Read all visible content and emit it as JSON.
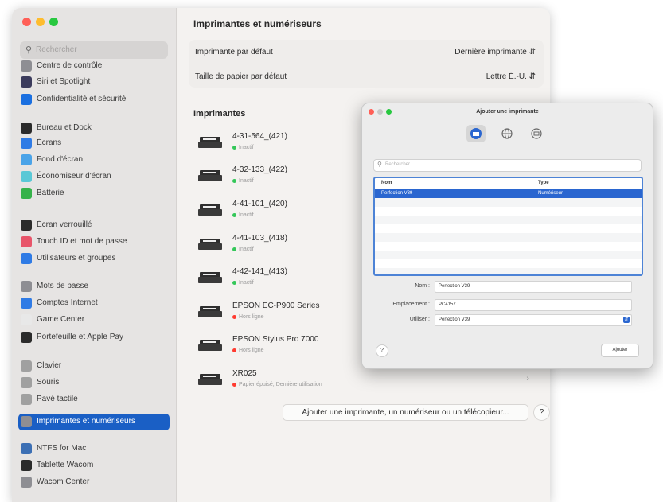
{
  "sidebar": {
    "search_placeholder": "Rechercher",
    "items": [
      {
        "label": "Centre de contrôle",
        "icon": "control-center-icon",
        "color": "#8e8e93"
      },
      {
        "label": "Siri et Spotlight",
        "icon": "siri-icon",
        "color": "#3b3b5c"
      },
      {
        "label": "Confidentialité et sécurité",
        "icon": "privacy-hand-icon",
        "color": "#1a6fe0"
      },
      {
        "label": "Bureau et Dock",
        "icon": "dock-icon",
        "color": "#2b2b2b"
      },
      {
        "label": "Écrans",
        "icon": "display-icon",
        "color": "#2f7be5"
      },
      {
        "label": "Fond d'écran",
        "icon": "wallpaper-icon",
        "color": "#4aa3e8"
      },
      {
        "label": "Économiseur d'écran",
        "icon": "screensaver-icon",
        "color": "#5ac8d6"
      },
      {
        "label": "Batterie",
        "icon": "battery-icon",
        "color": "#36b24a"
      },
      {
        "label": "Écran verrouillé",
        "icon": "lock-screen-icon",
        "color": "#2b2b2b"
      },
      {
        "label": "Touch ID et mot de passe",
        "icon": "fingerprint-icon",
        "color": "#e8556a"
      },
      {
        "label": "Utilisateurs et groupes",
        "icon": "users-icon",
        "color": "#2f7be5"
      },
      {
        "label": "Mots de passe",
        "icon": "key-icon",
        "color": "#8e8e93"
      },
      {
        "label": "Comptes Internet",
        "icon": "at-icon",
        "color": "#2f7be5"
      },
      {
        "label": "Game Center",
        "icon": "game-center-icon",
        "color": "#e8e8e8"
      },
      {
        "label": "Portefeuille et Apple Pay",
        "icon": "wallet-icon",
        "color": "#2b2b2b"
      },
      {
        "label": "Clavier",
        "icon": "keyboard-icon",
        "color": "#a0a0a0"
      },
      {
        "label": "Souris",
        "icon": "mouse-icon",
        "color": "#a0a0a0"
      },
      {
        "label": "Pavé tactile",
        "icon": "trackpad-icon",
        "color": "#a0a0a0"
      },
      {
        "label": "Imprimantes et numériseurs",
        "icon": "printer-icon",
        "color": "#8e8e93",
        "selected": true
      },
      {
        "label": "NTFS for Mac",
        "icon": "ntfs-icon",
        "color": "#3c6fb4"
      },
      {
        "label": "Tablette Wacom",
        "icon": "wacom-tablet-icon",
        "color": "#2b2b2b"
      },
      {
        "label": "Wacom Center",
        "icon": "wacom-center-icon",
        "color": "#8e8e93"
      }
    ]
  },
  "main": {
    "title": "Imprimantes et numériseurs",
    "default_printer_label": "Imprimante par défaut",
    "default_printer_value": "Dernière imprimante",
    "paper_size_label": "Taille de papier par défaut",
    "paper_size_value": "Lettre É.-U.",
    "printers_heading": "Imprimantes",
    "printers": [
      {
        "name": "4-31-564_(421)",
        "status": "Inactif",
        "status_color": "#34c759",
        "icon": "laser-printer-icon"
      },
      {
        "name": "4-32-133_(422)",
        "status": "Inactif",
        "status_color": "#34c759",
        "icon": "laser-printer-icon"
      },
      {
        "name": "4-41-101_(420)",
        "status": "Inactif",
        "status_color": "#34c759",
        "icon": "laser-printer-icon"
      },
      {
        "name": "4-41-103_(418)",
        "status": "Inactif",
        "status_color": "#34c759",
        "icon": "laser-printer-icon"
      },
      {
        "name": "4-42-141_(413)",
        "status": "Inactif",
        "status_color": "#34c759",
        "icon": "laser-printer-icon"
      },
      {
        "name": "EPSON EC-P900 Series",
        "status": "Hors ligne",
        "status_color": "#ff3b30",
        "icon": "epson-printer-icon"
      },
      {
        "name": "EPSON Stylus Pro 7000",
        "status": "Hors ligne",
        "status_color": "#ff3b30",
        "icon": "large-format-printer-icon"
      },
      {
        "name": "XR025",
        "status": "Papier épuisé, Dernière utilisation",
        "status_color": "#ff3b30",
        "icon": "scanner-icon"
      }
    ],
    "add_button_label": "Ajouter une imprimante, un numériseur ou un télécopieur...",
    "help_label": "?"
  },
  "dialog": {
    "title": "Ajouter une imprimante",
    "toolbar": [
      {
        "icon": "default-printer-icon",
        "selected": true
      },
      {
        "icon": "ip-globe-icon",
        "selected": false
      },
      {
        "icon": "windows-printer-icon",
        "selected": false
      }
    ],
    "search_placeholder": "Rechercher",
    "columns": {
      "name": "Nom",
      "type": "Type"
    },
    "rows": [
      {
        "name": "Perfection V39",
        "type": "Numériseur",
        "selected": true
      }
    ],
    "name_label": "Nom :",
    "name_value": "Perfection V39",
    "location_label": "Emplacement :",
    "location_value": "PC4157",
    "use_label": "Utiliser :",
    "use_value": "Perfection V39",
    "help_label": "?",
    "add_label": "Ajouter"
  }
}
